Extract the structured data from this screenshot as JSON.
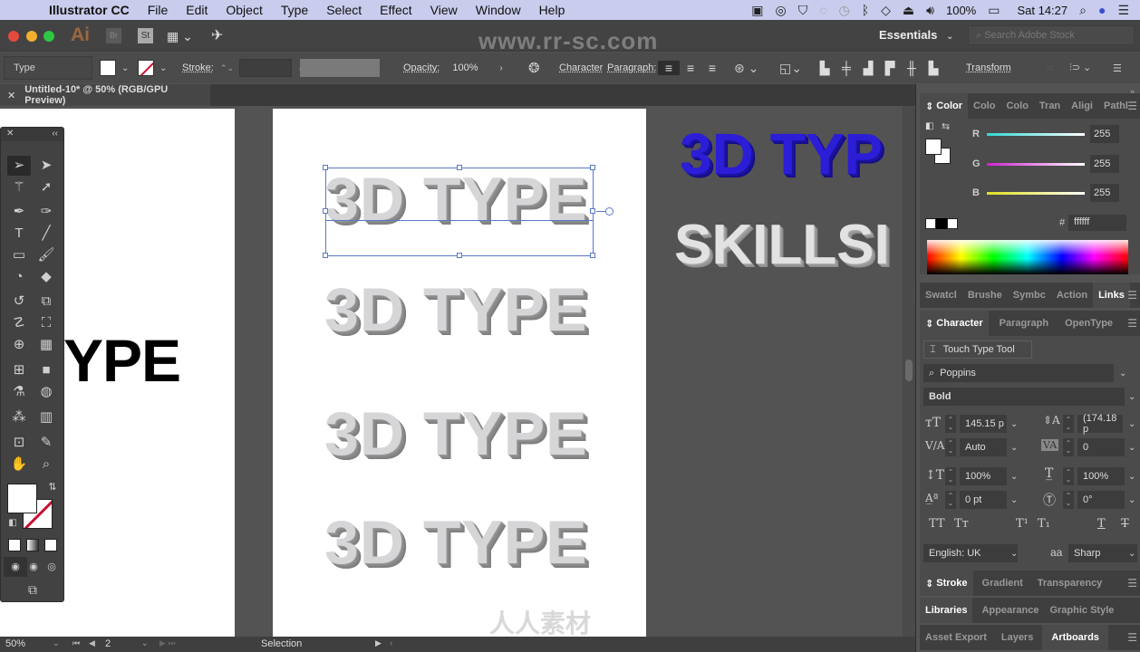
{
  "menubar": {
    "app": "Illustrator CC",
    "items": [
      "File",
      "Edit",
      "Object",
      "Type",
      "Select",
      "Effect",
      "View",
      "Window",
      "Help"
    ],
    "battery": "100%",
    "clock": "Sat 14:27"
  },
  "appbar": {
    "app_icon": "Ai",
    "bridge": "Br",
    "stock": "St",
    "watermark": "www.rr-sc.com",
    "workspace": "Essentials",
    "search_placeholder": "Search Adobe Stock"
  },
  "controlbar": {
    "selection_type": "Type",
    "stroke_label": "Stroke:",
    "opacity_label": "Opacity:",
    "opacity_value": "100%",
    "character_label": "Character",
    "paragraph_label": "Paragraph:",
    "transform_label": "Transform"
  },
  "document": {
    "tab_title": "Untitled-10* @ 50% (RGB/GPU Preview)"
  },
  "canvas": {
    "artboard1_text": "YPE",
    "artboard2_texts": [
      "3D TYPE",
      "3D TYPE",
      "3D TYPE",
      "3D TYPE"
    ],
    "pasteboard_blue_text": "3D TYP",
    "pasteboard_white_text": "SKILLSI"
  },
  "colorpanel": {
    "tabs": [
      "Color",
      "Colo",
      "Colo",
      "Tran",
      "Aligi",
      "Pathl"
    ],
    "r_label": "R",
    "g_label": "G",
    "b_label": "B",
    "r": "255",
    "g": "255",
    "b": "255",
    "hex_label": "#",
    "hex": "ffffff",
    "colors": {
      "r_slider": "#33d6d6",
      "g_slider": "#d020d0",
      "b_slider": "#e0e020"
    }
  },
  "swatchtabs": [
    "Swatcl",
    "Brushe",
    "Symbc",
    "Action",
    "Links"
  ],
  "character": {
    "tabs": [
      "Character",
      "Paragraph",
      "OpenType"
    ],
    "touch_type": "Touch Type Tool",
    "font_family": "Poppins",
    "font_style": "Bold",
    "font_size": "145.15 p",
    "leading": "(174.18 p",
    "kerning": "Auto",
    "tracking": "0",
    "vscale": "100%",
    "hscale": "100%",
    "baseline": "0 pt",
    "rotation": "0°",
    "language": "English: UK",
    "antialias": "Sharp",
    "aa_icon": "aa"
  },
  "bottomtabs": {
    "row1": [
      "Stroke",
      "Gradient",
      "Transparency"
    ],
    "row2": [
      "Libraries",
      "Appearance",
      "Graphic Style"
    ],
    "row3": [
      "Asset Export",
      "Layers",
      "Artboards"
    ]
  },
  "statusbar": {
    "zoom": "50%",
    "artboard": "2",
    "tool": "Selection"
  },
  "watermark_logo": "人人素材"
}
